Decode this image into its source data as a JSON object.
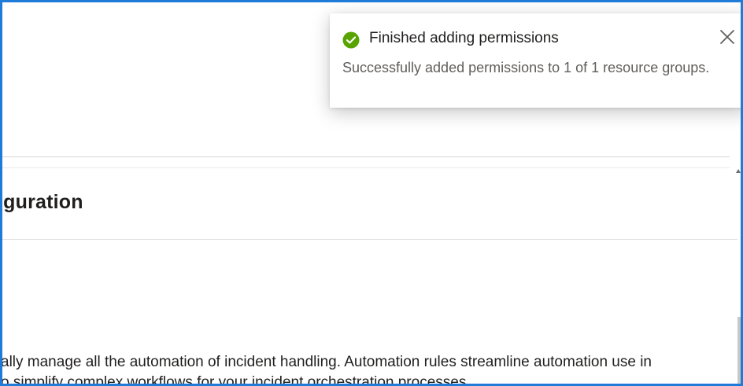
{
  "section": {
    "heading": "iguration",
    "description_lines": [
      "ally manage all the automation of incident handling. Automation rules streamline automation use in",
      "o simplify complex workflows for your incident orchestration processes."
    ]
  },
  "toast": {
    "icon": "success-check-icon",
    "title": "Finished adding permissions",
    "body": "Successfully added permissions to 1 of 1 resource groups.",
    "close_icon": "close-icon",
    "status_color": "#57a300"
  },
  "colors": {
    "frame_border": "#1f7bd8",
    "text": "#201f1e",
    "secondary_text": "#605e5c"
  }
}
